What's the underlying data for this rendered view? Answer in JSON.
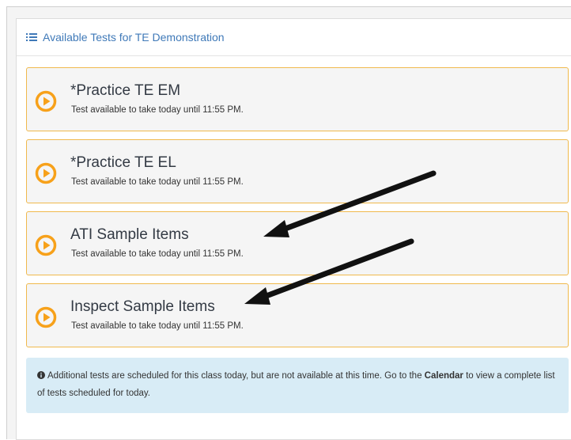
{
  "panel": {
    "title": "Available Tests for TE Demonstration",
    "icon": "list-icon"
  },
  "tests": [
    {
      "name": "*Practice TE EM",
      "status": "Test available to take today until 11:55 PM.",
      "icon": "play-circle-icon"
    },
    {
      "name": "*Practice TE EL",
      "status": "Test available to take today until 11:55 PM.",
      "icon": "play-circle-icon"
    },
    {
      "name": "ATI Sample Items",
      "status": "Test available to take today until 11:55 PM.",
      "icon": "play-circle-icon"
    },
    {
      "name": "Inspect Sample Items",
      "status": "Test available to take today until 11:55 PM.",
      "icon": "play-circle-icon"
    }
  ],
  "info": {
    "icon": "info-circle-icon",
    "text_before": "Additional tests are scheduled for this class today, but are not available at this time. Go to the ",
    "link_text": "Calendar",
    "text_after": " to view a complete list of tests scheduled for today."
  },
  "colors": {
    "accent_orange": "#f7a11a",
    "card_border": "#f0b94d",
    "title_blue": "#3f79b8",
    "info_background": "#d8ecf6"
  },
  "annotations": {
    "arrow_icon": "black-arrow-annotation"
  }
}
